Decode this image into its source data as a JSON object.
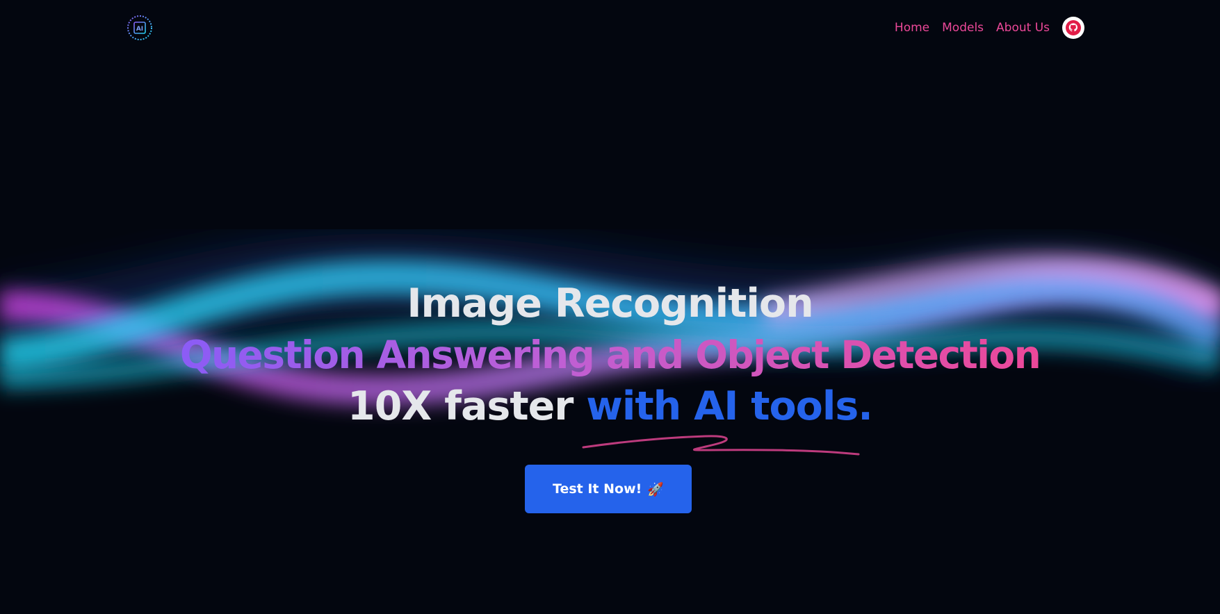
{
  "nav": {
    "logo_icon": "ai-chip-logo",
    "links": [
      "Home",
      "Models",
      "About Us"
    ],
    "github_icon": "github-icon"
  },
  "hero": {
    "line1": "Image Recognition",
    "line2": "Question Answering and Object Detection",
    "line3_prefix": "10X faster ",
    "line3_accent": "with AI tools.",
    "cta_label": "Test It Now!",
    "cta_icon": "🚀"
  },
  "colors": {
    "background": "#03060f",
    "nav_link": "#ec4899",
    "accent_blue": "#2563eb",
    "gradient_start": "#8b5cf6",
    "gradient_end": "#ec4899",
    "wave_cyan": "#22d3ee",
    "wave_pink": "#d946ef"
  }
}
